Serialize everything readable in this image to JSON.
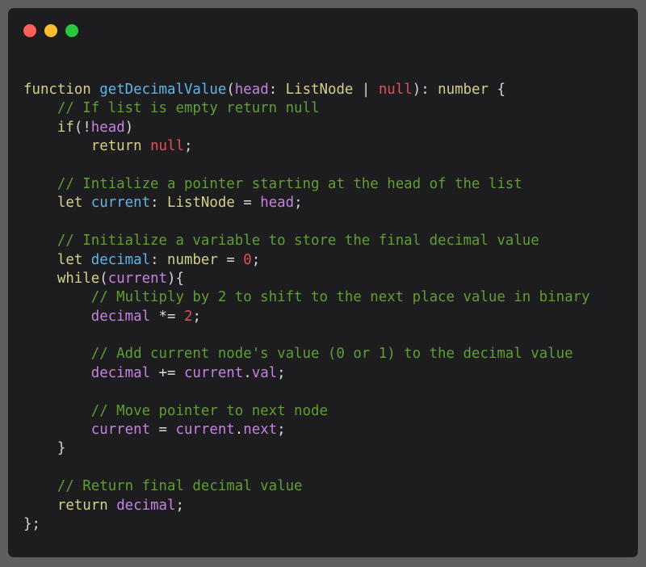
{
  "window": {
    "traffic_lights": [
      {
        "name": "close",
        "color": "#fe5f57"
      },
      {
        "name": "minimize",
        "color": "#febc2e"
      },
      {
        "name": "maximize",
        "color": "#28c840"
      }
    ]
  },
  "code": {
    "language": "typescript",
    "lines": [
      [
        {
          "t": "function",
          "c": "keyword"
        },
        {
          "t": " ",
          "c": "plain"
        },
        {
          "t": "getDecimalValue",
          "c": "fn"
        },
        {
          "t": "(",
          "c": "plain"
        },
        {
          "t": "head",
          "c": "param"
        },
        {
          "t": ": ",
          "c": "plain"
        },
        {
          "t": "ListNode",
          "c": "type"
        },
        {
          "t": " | ",
          "c": "plain"
        },
        {
          "t": "null",
          "c": "null"
        },
        {
          "t": "): ",
          "c": "plain"
        },
        {
          "t": "number",
          "c": "type"
        },
        {
          "t": " {",
          "c": "plain"
        }
      ],
      [
        {
          "t": "    ",
          "c": "plain"
        },
        {
          "t": "// If list is empty return null",
          "c": "comment"
        }
      ],
      [
        {
          "t": "    ",
          "c": "plain"
        },
        {
          "t": "if",
          "c": "keyword"
        },
        {
          "t": "(!",
          "c": "plain"
        },
        {
          "t": "head",
          "c": "param"
        },
        {
          "t": ")",
          "c": "plain"
        }
      ],
      [
        {
          "t": "        ",
          "c": "plain"
        },
        {
          "t": "return",
          "c": "keyword"
        },
        {
          "t": " ",
          "c": "plain"
        },
        {
          "t": "null",
          "c": "null"
        },
        {
          "t": ";",
          "c": "plain"
        }
      ],
      [],
      [
        {
          "t": "    ",
          "c": "plain"
        },
        {
          "t": "// Intialize a pointer starting at the head of the list",
          "c": "comment"
        }
      ],
      [
        {
          "t": "    ",
          "c": "plain"
        },
        {
          "t": "let",
          "c": "keyword"
        },
        {
          "t": " ",
          "c": "plain"
        },
        {
          "t": "current",
          "c": "fn"
        },
        {
          "t": ": ",
          "c": "plain"
        },
        {
          "t": "ListNode",
          "c": "type"
        },
        {
          "t": " = ",
          "c": "plain"
        },
        {
          "t": "head",
          "c": "param"
        },
        {
          "t": ";",
          "c": "plain"
        }
      ],
      [],
      [
        {
          "t": "    ",
          "c": "plain"
        },
        {
          "t": "// Initialize a variable to store the final decimal value",
          "c": "comment"
        }
      ],
      [
        {
          "t": "    ",
          "c": "plain"
        },
        {
          "t": "let",
          "c": "keyword"
        },
        {
          "t": " ",
          "c": "plain"
        },
        {
          "t": "decimal",
          "c": "fn"
        },
        {
          "t": ": ",
          "c": "plain"
        },
        {
          "t": "number",
          "c": "type"
        },
        {
          "t": " = ",
          "c": "plain"
        },
        {
          "t": "0",
          "c": "number"
        },
        {
          "t": ";",
          "c": "plain"
        }
      ],
      [
        {
          "t": "    ",
          "c": "plain"
        },
        {
          "t": "while",
          "c": "keyword"
        },
        {
          "t": "(",
          "c": "plain"
        },
        {
          "t": "current",
          "c": "param"
        },
        {
          "t": "){",
          "c": "plain"
        }
      ],
      [
        {
          "t": "        ",
          "c": "plain"
        },
        {
          "t": "// Multiply by 2 to shift to the next place value in binary",
          "c": "comment"
        }
      ],
      [
        {
          "t": "        ",
          "c": "plain"
        },
        {
          "t": "decimal",
          "c": "param"
        },
        {
          "t": " *= ",
          "c": "plain"
        },
        {
          "t": "2",
          "c": "number"
        },
        {
          "t": ";",
          "c": "plain"
        }
      ],
      [],
      [
        {
          "t": "        ",
          "c": "plain"
        },
        {
          "t": "// Add current node's value (0 or 1) to the decimal value",
          "c": "comment"
        }
      ],
      [
        {
          "t": "        ",
          "c": "plain"
        },
        {
          "t": "decimal",
          "c": "param"
        },
        {
          "t": " += ",
          "c": "plain"
        },
        {
          "t": "current",
          "c": "param"
        },
        {
          "t": ".",
          "c": "plain"
        },
        {
          "t": "val",
          "c": "prop"
        },
        {
          "t": ";",
          "c": "plain"
        }
      ],
      [],
      [
        {
          "t": "        ",
          "c": "plain"
        },
        {
          "t": "// Move pointer to next node",
          "c": "comment"
        }
      ],
      [
        {
          "t": "        ",
          "c": "plain"
        },
        {
          "t": "current",
          "c": "param"
        },
        {
          "t": " = ",
          "c": "plain"
        },
        {
          "t": "current",
          "c": "param"
        },
        {
          "t": ".",
          "c": "plain"
        },
        {
          "t": "next",
          "c": "prop"
        },
        {
          "t": ";",
          "c": "plain"
        }
      ],
      [
        {
          "t": "    ",
          "c": "plain"
        },
        {
          "t": "}",
          "c": "plain"
        }
      ],
      [],
      [
        {
          "t": "    ",
          "c": "plain"
        },
        {
          "t": "// Return final decimal value",
          "c": "comment"
        }
      ],
      [
        {
          "t": "    ",
          "c": "plain"
        },
        {
          "t": "return",
          "c": "keyword"
        },
        {
          "t": " ",
          "c": "plain"
        },
        {
          "t": "decimal",
          "c": "param"
        },
        {
          "t": ";",
          "c": "plain"
        }
      ],
      [
        {
          "t": "};",
          "c": "plain"
        }
      ]
    ]
  }
}
